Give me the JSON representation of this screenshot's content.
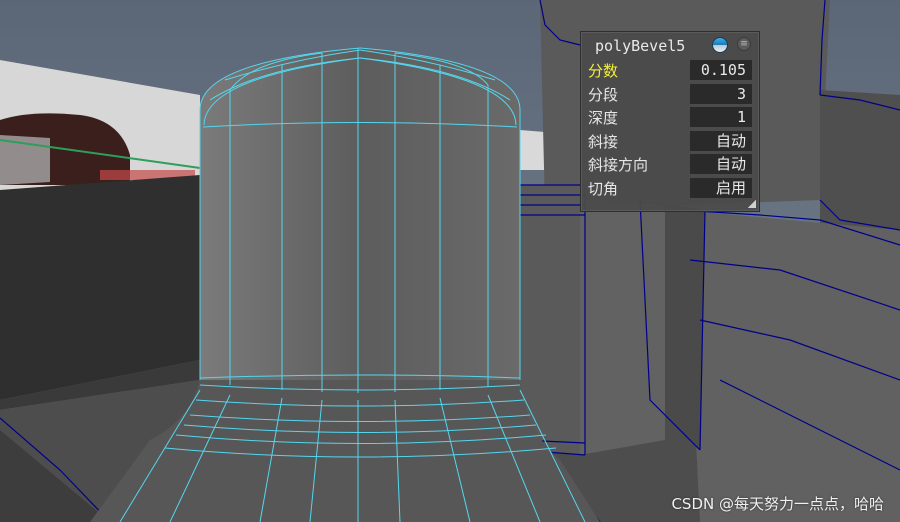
{
  "hud": {
    "title": "polyBevel5",
    "rows": [
      {
        "label": "分数",
        "value": "0.105",
        "highlighted": true
      },
      {
        "label": "分段",
        "value": "3"
      },
      {
        "label": "深度",
        "value": "1"
      },
      {
        "label": "斜接",
        "value": "自动"
      },
      {
        "label": "斜接方向",
        "value": "自动"
      },
      {
        "label": "切角",
        "value": "启用"
      }
    ],
    "icons": {
      "lock": "lock-icon",
      "menu": "menu-icon"
    }
  },
  "watermark": "CSDN @每天努力一点点，哈哈",
  "colors": {
    "wireframe": "#55d6ee",
    "selected_wire": "#000090",
    "mesh_gray": "#696969",
    "viewport_bg": "#5d6a79",
    "hud_highlight": "#f2ee3c"
  }
}
